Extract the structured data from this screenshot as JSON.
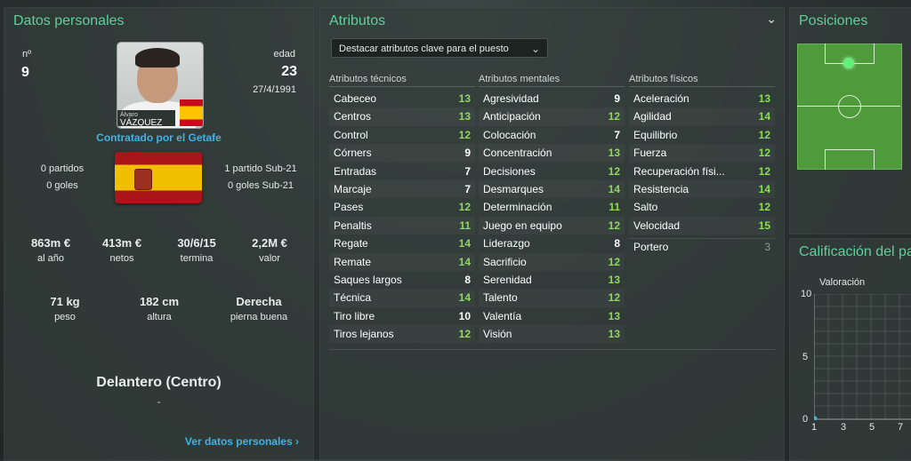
{
  "datos": {
    "title": "Datos personales",
    "num_label": "nº",
    "num_value": "9",
    "edad_label": "edad",
    "edad_value": "23",
    "birth": "27/4/1991",
    "photo_first": "Álvaro",
    "photo_last": "VÁZQUEZ",
    "contract": "Contratado por el Getafe",
    "partidos": "0 partidos",
    "goles": "0 goles",
    "partidos_sub21": "1 partido Sub-21",
    "goles_sub21": "0 goles Sub-21",
    "stats": [
      {
        "value": "863m €",
        "label": "al año"
      },
      {
        "value": "413m €",
        "label": "netos"
      },
      {
        "value": "30/6/15",
        "label": "termina"
      },
      {
        "value": "2,2M €",
        "label": "valor"
      }
    ],
    "body": [
      {
        "value": "71 kg",
        "label": "peso"
      },
      {
        "value": "182 cm",
        "label": "altura"
      },
      {
        "value": "Derecha",
        "label": "pierna buena"
      }
    ],
    "position": "Delantero (Centro)",
    "position_sub": "-",
    "link": "Ver datos personales"
  },
  "atributos": {
    "title": "Atributos",
    "dropdown": "Destacar atributos clave para el puesto",
    "tecnicos": {
      "header": "Atributos técnicos",
      "items": [
        {
          "name": "Cabeceo",
          "value": "13",
          "color": "g"
        },
        {
          "name": "Centros",
          "value": "13",
          "color": "g"
        },
        {
          "name": "Control",
          "value": "12",
          "color": "g"
        },
        {
          "name": "Córners",
          "value": "9",
          "color": "w"
        },
        {
          "name": "Entradas",
          "value": "7",
          "color": "w"
        },
        {
          "name": "Marcaje",
          "value": "7",
          "color": "w"
        },
        {
          "name": "Pases",
          "value": "12",
          "color": "g"
        },
        {
          "name": "Penaltis",
          "value": "11",
          "color": "g"
        },
        {
          "name": "Regate",
          "value": "14",
          "color": "g"
        },
        {
          "name": "Remate",
          "value": "14",
          "color": "g"
        },
        {
          "name": "Saques largos",
          "value": "8",
          "color": "w"
        },
        {
          "name": "Técnica",
          "value": "14",
          "color": "g"
        },
        {
          "name": "Tiro libre",
          "value": "10",
          "color": "w"
        },
        {
          "name": "Tiros lejanos",
          "value": "12",
          "color": "g"
        }
      ]
    },
    "mentales": {
      "header": "Atributos mentales",
      "items": [
        {
          "name": "Agresividad",
          "value": "9",
          "color": "w"
        },
        {
          "name": "Anticipación",
          "value": "12",
          "color": "g"
        },
        {
          "name": "Colocación",
          "value": "7",
          "color": "w"
        },
        {
          "name": "Concentración",
          "value": "13",
          "color": "g"
        },
        {
          "name": "Decisiones",
          "value": "12",
          "color": "g"
        },
        {
          "name": "Desmarques",
          "value": "14",
          "color": "g"
        },
        {
          "name": "Determinación",
          "value": "11",
          "color": "g"
        },
        {
          "name": "Juego en equipo",
          "value": "12",
          "color": "g"
        },
        {
          "name": "Liderazgo",
          "value": "8",
          "color": "w"
        },
        {
          "name": "Sacrificio",
          "value": "12",
          "color": "g"
        },
        {
          "name": "Serenidad",
          "value": "13",
          "color": "g"
        },
        {
          "name": "Talento",
          "value": "12",
          "color": "g"
        },
        {
          "name": "Valentía",
          "value": "13",
          "color": "g"
        },
        {
          "name": "Visión",
          "value": "13",
          "color": "g"
        }
      ]
    },
    "fisicos": {
      "header": "Atributos físicos",
      "items": [
        {
          "name": "Aceleración",
          "value": "13",
          "color": "g"
        },
        {
          "name": "Agilidad",
          "value": "14",
          "color": "g"
        },
        {
          "name": "Equilibrio",
          "value": "12",
          "color": "g"
        },
        {
          "name": "Fuerza",
          "value": "12",
          "color": "g"
        },
        {
          "name": "Recuperación físi...",
          "value": "12",
          "color": "g"
        },
        {
          "name": "Resistencia",
          "value": "14",
          "color": "g"
        },
        {
          "name": "Salto",
          "value": "12",
          "color": "g"
        },
        {
          "name": "Velocidad",
          "value": "15",
          "color": "g"
        }
      ],
      "portero": {
        "name": "Portero",
        "value": "3"
      }
    }
  },
  "posiciones": {
    "title": "Posiciones"
  },
  "calificacion": {
    "title": "Calificación del pa",
    "chart_label": "Valoración",
    "y_ticks": [
      "10",
      "5",
      "0"
    ],
    "x_ticks": [
      "1",
      "3",
      "5",
      "7"
    ]
  },
  "colors": {
    "accent": "#5fcf9c",
    "good": "#8bdc5a",
    "link": "#3fb3e9"
  }
}
